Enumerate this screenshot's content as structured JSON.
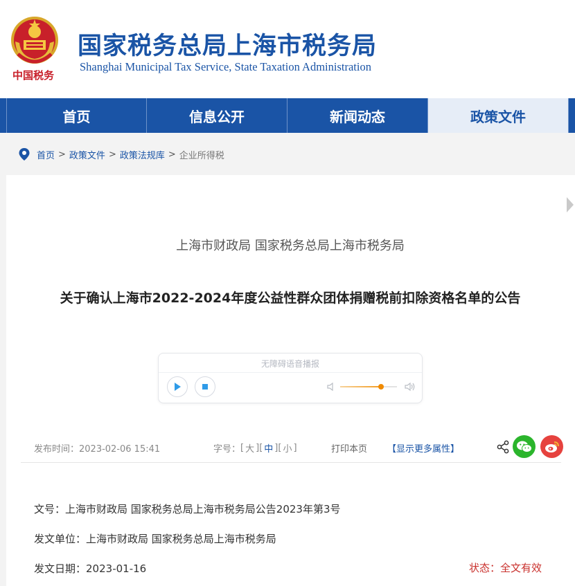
{
  "header": {
    "title": "国家税务总局上海市税务局",
    "subtitle": "Shanghai Municipal Tax Service, State Taxation Administration",
    "emblem_text": "中国税务"
  },
  "nav": {
    "items": [
      {
        "label": "首页"
      },
      {
        "label": "信息公开"
      },
      {
        "label": "新闻动态"
      },
      {
        "label": "政策文件"
      }
    ],
    "active_index": 3
  },
  "breadcrumb": {
    "items": [
      "首页",
      "政策文件",
      "政策法规库"
    ],
    "separator": ">",
    "current": "企业所得税"
  },
  "article": {
    "issuer": "上海市财政局 国家税务总局上海市税务局",
    "title": "关于确认上海市2022-2024年度公益性群众团体捐赠税前扣除资格名单的公告"
  },
  "audio": {
    "label": "无障碍语音播报",
    "volume": 0.72
  },
  "meta": {
    "publish_time": "发布时间：2023-02-06 15:41",
    "font_size_label": "字号：",
    "font_sizes": [
      "大",
      "中",
      "小"
    ],
    "font_size_selected": "中",
    "print": "打印本页",
    "more_attributes": "【显示更多属性】"
  },
  "attributes": {
    "doc_no_label": "文号：",
    "doc_no": "上海市财政局 国家税务总局上海市税务局公告2023年第3号",
    "unit_label": "发文单位：",
    "unit": "上海市财政局 国家税务总局上海市税务局",
    "date_label": "发文日期：",
    "date": "2023-01-16",
    "status_label": "状态：",
    "status": "全文有效"
  },
  "icons": [
    "emblem-icon",
    "location-pin-icon",
    "play-icon",
    "stop-icon",
    "volume-low-icon",
    "volume-high-icon",
    "share-icon",
    "wechat-icon",
    "weibo-icon",
    "chevron-right-icon"
  ],
  "colors": {
    "brand_blue": "#1a54a6",
    "nav_active_bg": "#e6edf7",
    "status_red": "#c9302c",
    "wechat_green": "#2bb52c",
    "weibo_red": "#e6423e"
  }
}
